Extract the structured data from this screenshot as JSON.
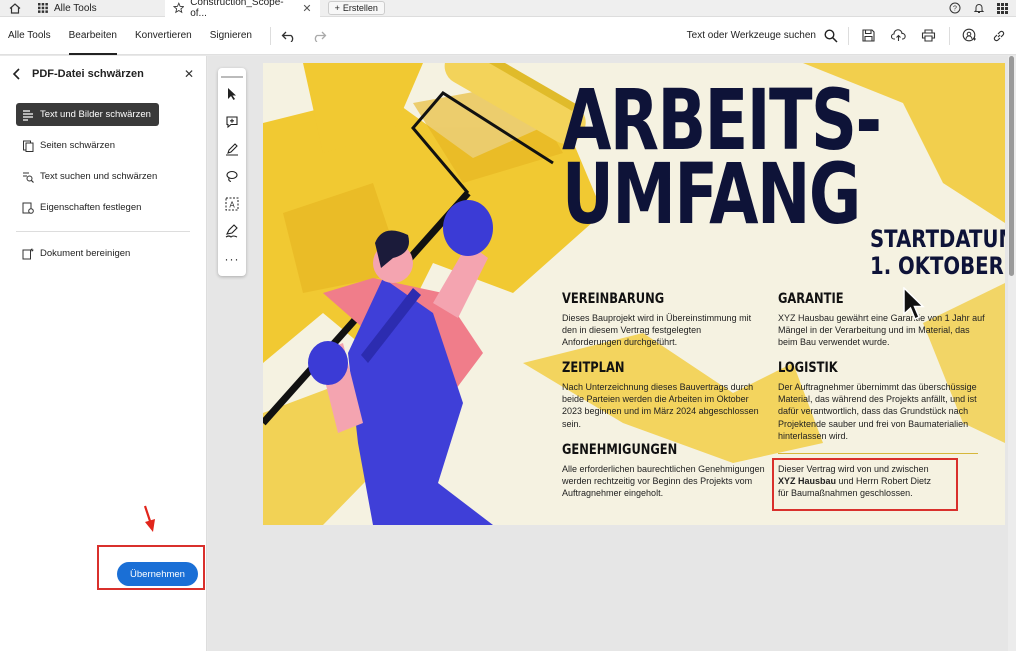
{
  "tabs": {
    "home_icon": "home-icon",
    "all_tools": "Alle Tools",
    "active_doc": "Construction_Scope-of...",
    "new_tab": "Erstellen"
  },
  "toolbar": {
    "menu": [
      "Alle Tools",
      "Bearbeiten",
      "Konvertieren",
      "Signieren"
    ],
    "active_menu": "Bearbeiten",
    "search_label": "Text oder Werkzeuge suchen"
  },
  "panel": {
    "title": "PDF-Datei schwärzen",
    "options": [
      {
        "label": "Text und Bilder schwärzen",
        "selected": true
      },
      {
        "label": "Seiten schwärzen",
        "selected": false
      },
      {
        "label": "Text suchen und schwärzen",
        "selected": false
      },
      {
        "label": "Eigenschaften festlegen",
        "selected": false
      }
    ],
    "extra_option": "Dokument bereinigen",
    "apply_label": "Übernehmen"
  },
  "document": {
    "headline_line1": "ARBEITS-",
    "headline_line2": "UMFANG",
    "start_line1": "STARTDATUM:",
    "start_line2": "1. OKTOBER",
    "sections": {
      "vereinbarung": {
        "title": "VEREINBARUNG",
        "body": "Dieses Bauprojekt wird in Übereinstimmung mit den in diesem Vertrag festgelegten Anforderungen durchgeführt."
      },
      "zeitplan": {
        "title": "ZEITPLAN",
        "body": "Nach Unterzeichnung dieses Bauvertrags durch beide Parteien werden die Arbeiten im Oktober 2023 beginnen und im März 2024 abgeschlossen sein."
      },
      "genehmigungen": {
        "title": "GENEHMIGUNGEN",
        "body": "Alle erforderlichen baurechtlichen Genehmigungen werden rechtzeitig vor Beginn des Projekts vom Auftragnehmer eingeholt."
      },
      "garantie": {
        "title": "GARANTIE",
        "body": "XYZ Hausbau gewährt eine Garantie von 1 Jahr auf Mängel in der Verarbeitung und im Material, das beim Bau verwendet wurde."
      },
      "logistik": {
        "title": "LOGISTIK",
        "body": "Der Auftragnehmer übernimmt das überschüssige Material, das während des Projekts anfällt, und ist dafür verantwortlich, dass das Grundstück nach Projektende sauber und frei von Baumaterialien hinterlassen wird."
      }
    },
    "contract": {
      "line1": "Dieser Vertrag wird von und zwischen",
      "party": "XYZ Hausbau",
      "line2_rest": " und Herrn Robert Dietz",
      "line3": "für Baumaßnahmen geschlossen."
    }
  },
  "colors": {
    "accent_blue": "#1a6fd6",
    "redact_red": "#d9302c",
    "headline_navy": "#0e1338",
    "paint_yellow": "#f1c932"
  }
}
